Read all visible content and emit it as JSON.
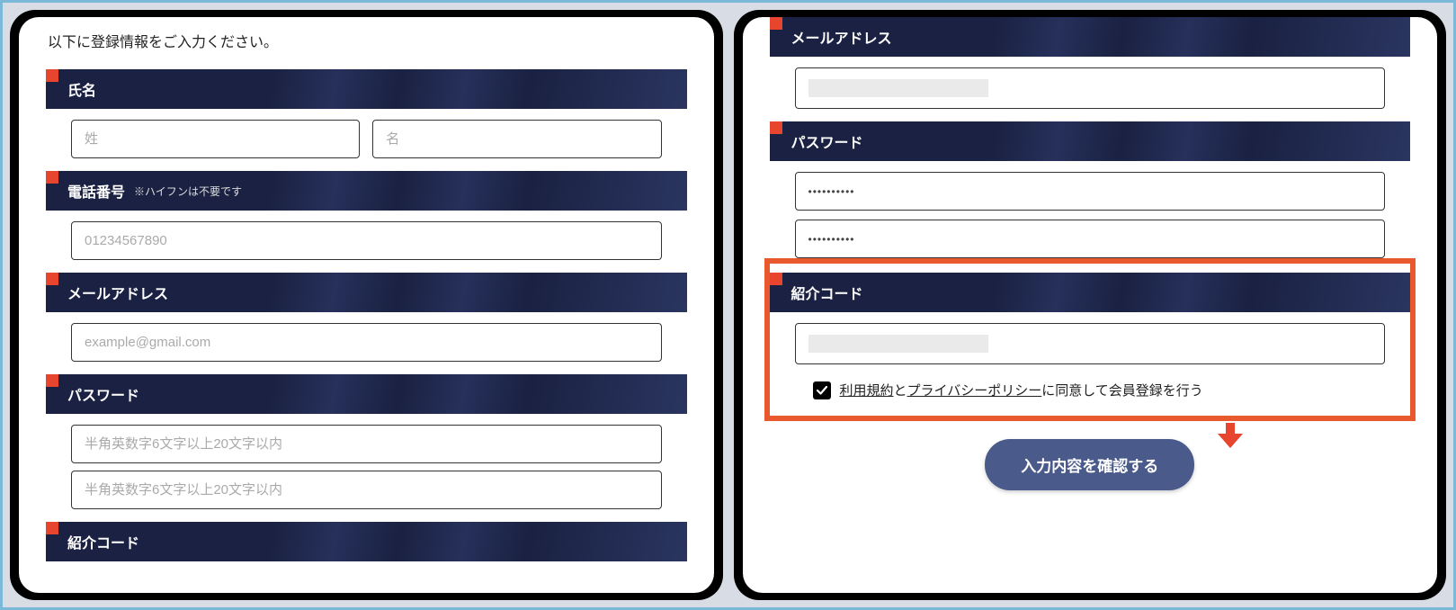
{
  "left": {
    "instruction": "以下に登録情報をご入力ください。",
    "sections": {
      "name": {
        "label": "氏名",
        "last_placeholder": "姓",
        "first_placeholder": "名"
      },
      "phone": {
        "label": "電話番号",
        "note": "※ハイフンは不要です",
        "placeholder": "01234567890"
      },
      "email": {
        "label": "メールアドレス",
        "placeholder": "example@gmail.com"
      },
      "password": {
        "label": "パスワード",
        "placeholder1": "半角英数字6文字以上20文字以内",
        "placeholder2": "半角英数字6文字以上20文字以内"
      },
      "referral": {
        "label": "紹介コード"
      }
    }
  },
  "right": {
    "sections": {
      "email": {
        "label": "メールアドレス"
      },
      "password": {
        "label": "パスワード",
        "masked1": "••••••••••",
        "masked2": "••••••••••"
      },
      "referral": {
        "label": "紹介コード"
      }
    },
    "consent": {
      "checked": true,
      "terms_link": "利用規約",
      "mid1": "と",
      "privacy_link": "プライバシーポリシー",
      "tail": "に同意して会員登録を行う"
    },
    "submit_label": "入力内容を確認する"
  }
}
